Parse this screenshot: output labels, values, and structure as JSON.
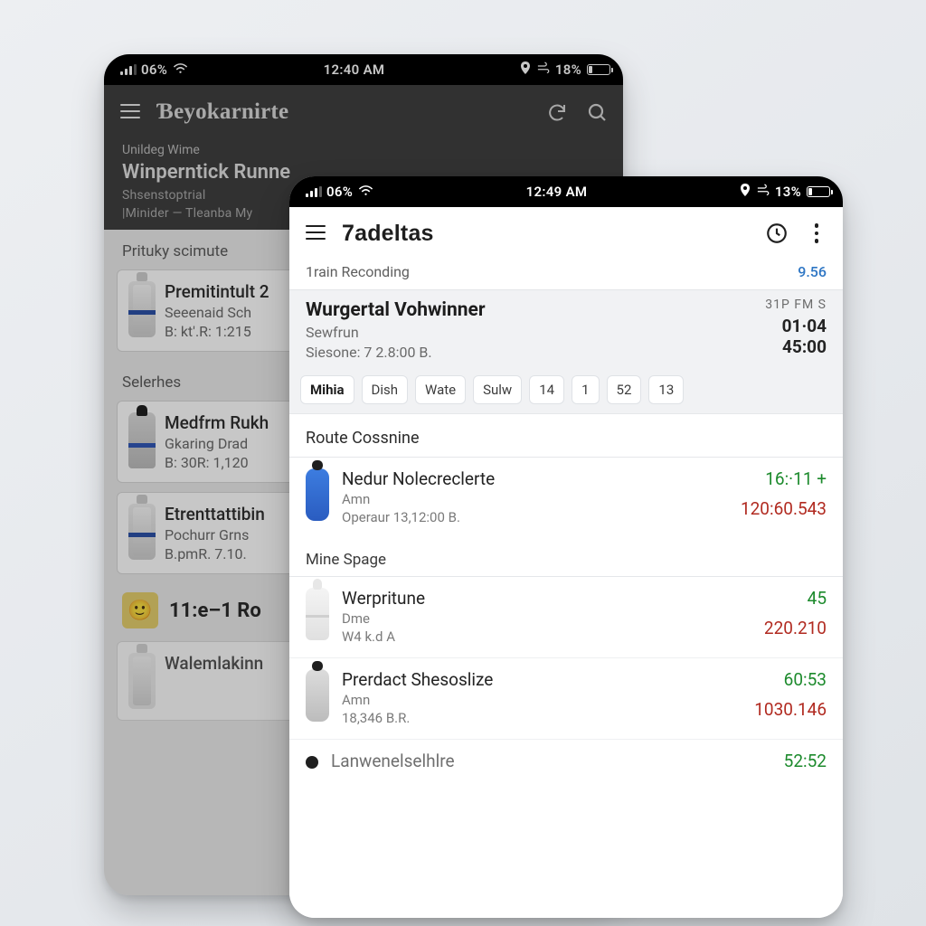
{
  "back": {
    "statusbar": {
      "carrier_pct": "06%",
      "time": "12:40 AM",
      "batt_pct": "18%"
    },
    "appbar": {
      "title": "Ɓeyokarnirte"
    },
    "subhead": {
      "small": "Unildeg Wime",
      "title": "Winperntick Runne",
      "line1": "Shsenstoptrial",
      "line2": "|Minider — Tleanba My"
    },
    "section1": "Prituky scimute",
    "card1": {
      "t1": "Premitintult 2",
      "t2": "Seeenaid Sch",
      "t3": "B: kt'.R:   1:215"
    },
    "section2": "Selerhes",
    "card2": {
      "t1": "Medfrm Rukh",
      "t2": "Gkaring Drad",
      "t3": "B: 30R:   1,120"
    },
    "card3": {
      "t1": "Etrenttattibin",
      "t2": "Pochurr Grns",
      "t3": "B.pmR.   7.10."
    },
    "emoji_label": "11:e–1 Ro",
    "card4_t1": "Walemlakinn"
  },
  "front": {
    "statusbar": {
      "carrier_pct": "06%",
      "time": "12:49 AM",
      "batt_pct": "13%"
    },
    "appbar": {
      "title": "7adeltas"
    },
    "thin": {
      "label": "1rain  Reconding",
      "value": "9.56"
    },
    "head": {
      "title": "Wurgertal Vohwinner",
      "sub1": "Sewfrun",
      "sub2": "Siesone: 7 2.8:00 B.",
      "r1": "31P FM  S",
      "r2": "01·04",
      "r3": "45:00"
    },
    "chips": [
      "Mihia",
      "Dish",
      "Wate",
      "Sulw",
      "14",
      "1",
      "52",
      "13"
    ],
    "section_a": "Route Cossnine",
    "itemA": {
      "n1": "Nedur Nolecreclerte",
      "n2": "Amn",
      "n3": "Operaur 13,12:00 B.",
      "g": "16:·11 +",
      "r": "120:60.543"
    },
    "section_b": "Mine Spage",
    "itemB": {
      "n1": "Werpritune",
      "n2": "Dme",
      "n3": "W4 k.d A",
      "g": "45",
      "r": "220.210"
    },
    "itemC": {
      "n1": "Prerdact Shesoslize",
      "n2": "Amn",
      "n3": "18,346 B.R.",
      "g": "60:53",
      "r": "1030.146"
    },
    "itemD": {
      "n1": "Lanwenelselhlre",
      "g": "52:52"
    }
  }
}
